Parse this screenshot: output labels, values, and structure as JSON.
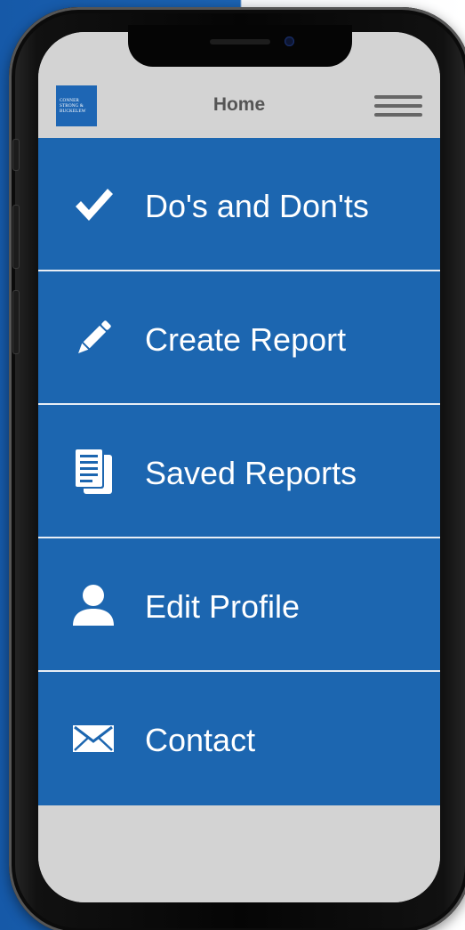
{
  "header": {
    "logo_lines": [
      "CONNER",
      "STRONG &",
      "BUCKELEW"
    ],
    "title": "Home"
  },
  "menu": {
    "items": [
      {
        "label": "Do's and Don'ts",
        "icon": "checkmark-icon"
      },
      {
        "label": "Create Report",
        "icon": "pencil-icon"
      },
      {
        "label": "Saved Reports",
        "icon": "documents-icon"
      },
      {
        "label": "Edit Profile",
        "icon": "user-icon"
      },
      {
        "label": "Contact",
        "icon": "envelope-icon"
      }
    ]
  },
  "colors": {
    "primary_blue": "#1c66b0",
    "header_gray": "#d3d3d3",
    "title_gray": "#555555",
    "divider": "#e8eef5"
  }
}
